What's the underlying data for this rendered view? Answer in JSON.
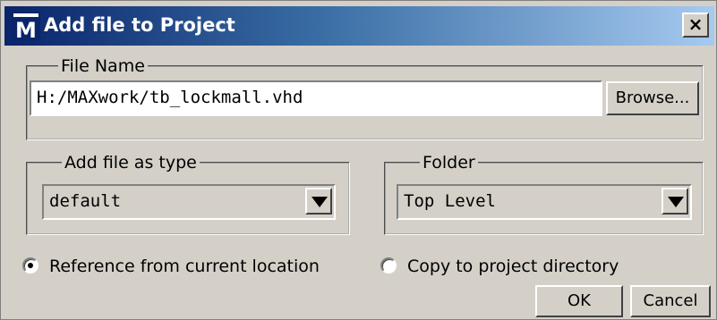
{
  "window": {
    "title": "Add file to Project",
    "icon": "M",
    "close_label": "×"
  },
  "file_name_group": {
    "legend": "File Name",
    "path_value": "H:/MAXwork/tb_lockmall.vhd",
    "browse_label": "Browse..."
  },
  "file_type_group": {
    "legend": "Add file as type",
    "selected": "default"
  },
  "folder_group": {
    "legend": "Folder",
    "selected": "Top Level"
  },
  "options": {
    "reference_label": "Reference from current location",
    "reference_checked": true,
    "copy_label": "Copy to project directory",
    "copy_checked": false
  },
  "buttons": {
    "ok_label": "OK",
    "cancel_label": "Cancel"
  }
}
